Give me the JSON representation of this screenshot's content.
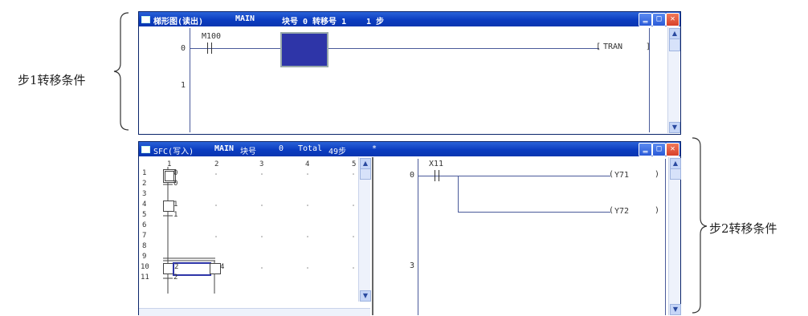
{
  "annotations": {
    "left": "步1转移条件",
    "right": "步2转移条件"
  },
  "top_window": {
    "title": {
      "app": "梯形图(读出)",
      "prog": "MAIN",
      "block": "块号 0 转移号 1",
      "step": "1 步"
    },
    "rows": [
      "0",
      "1"
    ],
    "contact": "M100",
    "coil": "TRAN"
  },
  "bottom_window": {
    "title": {
      "app": "SFC(写入)",
      "prog": "MAIN",
      "block": "块号",
      "block_no": "0",
      "total": "Total",
      "steps": "49步",
      "mark": "*"
    },
    "sfc": {
      "columns": [
        "1",
        "2",
        "3",
        "4",
        "5"
      ],
      "rows": [
        "1",
        "2",
        "3",
        "4",
        "5",
        "6",
        "7",
        "8",
        "9",
        "10",
        "11"
      ],
      "labels": [
        "0",
        "0",
        "1",
        "1",
        "2",
        "4",
        "2"
      ]
    },
    "ladder": {
      "rows": [
        "0",
        "3"
      ],
      "contact": "X11",
      "coils": [
        "Y71",
        "Y72"
      ]
    }
  },
  "colors": {
    "titlebar": "#0b3cc0",
    "highlight": "#2e35a8"
  }
}
